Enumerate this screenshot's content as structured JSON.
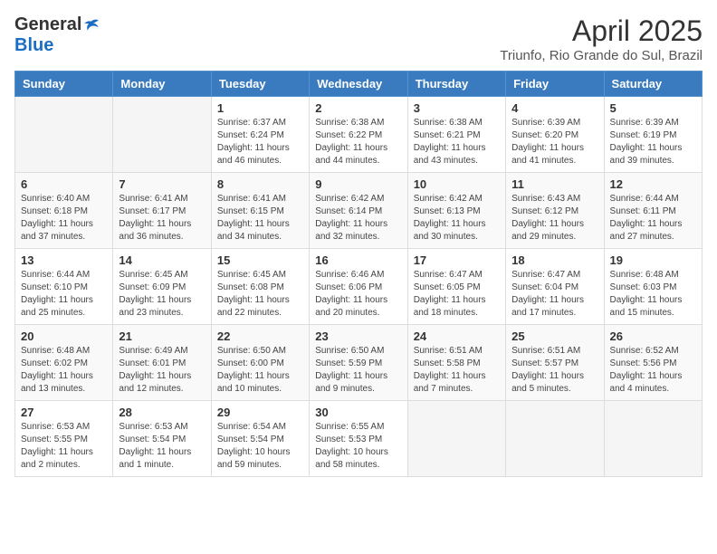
{
  "logo": {
    "general": "General",
    "blue": "Blue"
  },
  "title": {
    "month_year": "April 2025",
    "location": "Triunfo, Rio Grande do Sul, Brazil"
  },
  "days_of_week": [
    "Sunday",
    "Monday",
    "Tuesday",
    "Wednesday",
    "Thursday",
    "Friday",
    "Saturday"
  ],
  "weeks": [
    [
      {
        "day": "",
        "info": ""
      },
      {
        "day": "",
        "info": ""
      },
      {
        "day": "1",
        "info": "Sunrise: 6:37 AM\nSunset: 6:24 PM\nDaylight: 11 hours and 46 minutes."
      },
      {
        "day": "2",
        "info": "Sunrise: 6:38 AM\nSunset: 6:22 PM\nDaylight: 11 hours and 44 minutes."
      },
      {
        "day": "3",
        "info": "Sunrise: 6:38 AM\nSunset: 6:21 PM\nDaylight: 11 hours and 43 minutes."
      },
      {
        "day": "4",
        "info": "Sunrise: 6:39 AM\nSunset: 6:20 PM\nDaylight: 11 hours and 41 minutes."
      },
      {
        "day": "5",
        "info": "Sunrise: 6:39 AM\nSunset: 6:19 PM\nDaylight: 11 hours and 39 minutes."
      }
    ],
    [
      {
        "day": "6",
        "info": "Sunrise: 6:40 AM\nSunset: 6:18 PM\nDaylight: 11 hours and 37 minutes."
      },
      {
        "day": "7",
        "info": "Sunrise: 6:41 AM\nSunset: 6:17 PM\nDaylight: 11 hours and 36 minutes."
      },
      {
        "day": "8",
        "info": "Sunrise: 6:41 AM\nSunset: 6:15 PM\nDaylight: 11 hours and 34 minutes."
      },
      {
        "day": "9",
        "info": "Sunrise: 6:42 AM\nSunset: 6:14 PM\nDaylight: 11 hours and 32 minutes."
      },
      {
        "day": "10",
        "info": "Sunrise: 6:42 AM\nSunset: 6:13 PM\nDaylight: 11 hours and 30 minutes."
      },
      {
        "day": "11",
        "info": "Sunrise: 6:43 AM\nSunset: 6:12 PM\nDaylight: 11 hours and 29 minutes."
      },
      {
        "day": "12",
        "info": "Sunrise: 6:44 AM\nSunset: 6:11 PM\nDaylight: 11 hours and 27 minutes."
      }
    ],
    [
      {
        "day": "13",
        "info": "Sunrise: 6:44 AM\nSunset: 6:10 PM\nDaylight: 11 hours and 25 minutes."
      },
      {
        "day": "14",
        "info": "Sunrise: 6:45 AM\nSunset: 6:09 PM\nDaylight: 11 hours and 23 minutes."
      },
      {
        "day": "15",
        "info": "Sunrise: 6:45 AM\nSunset: 6:08 PM\nDaylight: 11 hours and 22 minutes."
      },
      {
        "day": "16",
        "info": "Sunrise: 6:46 AM\nSunset: 6:06 PM\nDaylight: 11 hours and 20 minutes."
      },
      {
        "day": "17",
        "info": "Sunrise: 6:47 AM\nSunset: 6:05 PM\nDaylight: 11 hours and 18 minutes."
      },
      {
        "day": "18",
        "info": "Sunrise: 6:47 AM\nSunset: 6:04 PM\nDaylight: 11 hours and 17 minutes."
      },
      {
        "day": "19",
        "info": "Sunrise: 6:48 AM\nSunset: 6:03 PM\nDaylight: 11 hours and 15 minutes."
      }
    ],
    [
      {
        "day": "20",
        "info": "Sunrise: 6:48 AM\nSunset: 6:02 PM\nDaylight: 11 hours and 13 minutes."
      },
      {
        "day": "21",
        "info": "Sunrise: 6:49 AM\nSunset: 6:01 PM\nDaylight: 11 hours and 12 minutes."
      },
      {
        "day": "22",
        "info": "Sunrise: 6:50 AM\nSunset: 6:00 PM\nDaylight: 11 hours and 10 minutes."
      },
      {
        "day": "23",
        "info": "Sunrise: 6:50 AM\nSunset: 5:59 PM\nDaylight: 11 hours and 9 minutes."
      },
      {
        "day": "24",
        "info": "Sunrise: 6:51 AM\nSunset: 5:58 PM\nDaylight: 11 hours and 7 minutes."
      },
      {
        "day": "25",
        "info": "Sunrise: 6:51 AM\nSunset: 5:57 PM\nDaylight: 11 hours and 5 minutes."
      },
      {
        "day": "26",
        "info": "Sunrise: 6:52 AM\nSunset: 5:56 PM\nDaylight: 11 hours and 4 minutes."
      }
    ],
    [
      {
        "day": "27",
        "info": "Sunrise: 6:53 AM\nSunset: 5:55 PM\nDaylight: 11 hours and 2 minutes."
      },
      {
        "day": "28",
        "info": "Sunrise: 6:53 AM\nSunset: 5:54 PM\nDaylight: 11 hours and 1 minute."
      },
      {
        "day": "29",
        "info": "Sunrise: 6:54 AM\nSunset: 5:54 PM\nDaylight: 10 hours and 59 minutes."
      },
      {
        "day": "30",
        "info": "Sunrise: 6:55 AM\nSunset: 5:53 PM\nDaylight: 10 hours and 58 minutes."
      },
      {
        "day": "",
        "info": ""
      },
      {
        "day": "",
        "info": ""
      },
      {
        "day": "",
        "info": ""
      }
    ]
  ]
}
